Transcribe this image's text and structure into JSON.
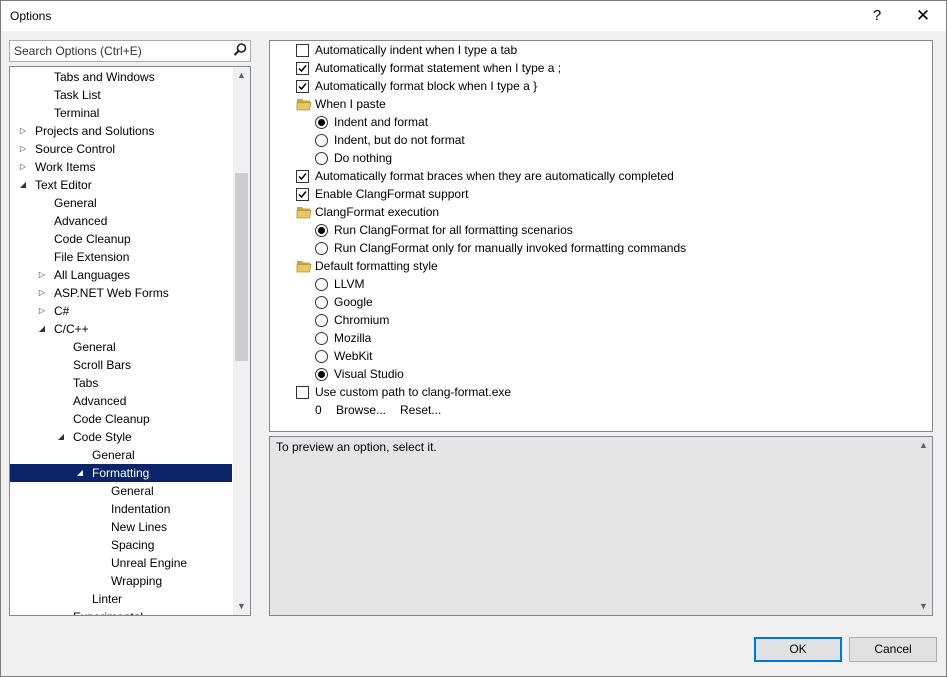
{
  "window": {
    "title": "Options",
    "help_label": "?",
    "close_label": "✕"
  },
  "search": {
    "placeholder": "Search Options (Ctrl+E)"
  },
  "tree": {
    "items": [
      {
        "label": "Tabs and Windows",
        "level": 2,
        "expander": ""
      },
      {
        "label": "Task List",
        "level": 2,
        "expander": ""
      },
      {
        "label": "Terminal",
        "level": 2,
        "expander": ""
      },
      {
        "label": "Projects and Solutions",
        "level": 1,
        "expander": "collapsed"
      },
      {
        "label": "Source Control",
        "level": 1,
        "expander": "collapsed"
      },
      {
        "label": "Work Items",
        "level": 1,
        "expander": "collapsed"
      },
      {
        "label": "Text Editor",
        "level": 1,
        "expander": "expanded"
      },
      {
        "label": "General",
        "level": 2,
        "expander": ""
      },
      {
        "label": "Advanced",
        "level": 2,
        "expander": ""
      },
      {
        "label": "Code Cleanup",
        "level": 2,
        "expander": ""
      },
      {
        "label": "File Extension",
        "level": 2,
        "expander": ""
      },
      {
        "label": "All Languages",
        "level": 2,
        "expander": "collapsed"
      },
      {
        "label": "ASP.NET Web Forms",
        "level": 2,
        "expander": "collapsed"
      },
      {
        "label": "C#",
        "level": 2,
        "expander": "collapsed"
      },
      {
        "label": "C/C++",
        "level": 2,
        "expander": "expanded"
      },
      {
        "label": "General",
        "level": 3,
        "expander": ""
      },
      {
        "label": "Scroll Bars",
        "level": 3,
        "expander": ""
      },
      {
        "label": "Tabs",
        "level": 3,
        "expander": ""
      },
      {
        "label": "Advanced",
        "level": 3,
        "expander": ""
      },
      {
        "label": "Code Cleanup",
        "level": 3,
        "expander": ""
      },
      {
        "label": "Code Style",
        "level": 3,
        "expander": "expanded"
      },
      {
        "label": "General",
        "level": 4,
        "expander": ""
      },
      {
        "label": "Formatting",
        "level": 4,
        "expander": "expanded",
        "selected": true
      },
      {
        "label": "General",
        "level": 5,
        "expander": ""
      },
      {
        "label": "Indentation",
        "level": 5,
        "expander": ""
      },
      {
        "label": "New Lines",
        "level": 5,
        "expander": ""
      },
      {
        "label": "Spacing",
        "level": 5,
        "expander": ""
      },
      {
        "label": "Unreal Engine",
        "level": 5,
        "expander": ""
      },
      {
        "label": "Wrapping",
        "level": 5,
        "expander": ""
      },
      {
        "label": "Linter",
        "level": 4,
        "expander": ""
      },
      {
        "label": "Experimental",
        "level": 3,
        "expander": ""
      }
    ]
  },
  "options": [
    {
      "type": "checkbox",
      "checked": false,
      "indent": 0,
      "label": "Automatically indent when I type a tab"
    },
    {
      "type": "checkbox",
      "checked": true,
      "indent": 0,
      "label": "Automatically format statement when I type a ;"
    },
    {
      "type": "checkbox",
      "checked": true,
      "indent": 0,
      "label": "Automatically format block when I type a }"
    },
    {
      "type": "folder",
      "indent": 0,
      "label": "When I paste"
    },
    {
      "type": "radio",
      "checked": true,
      "indent": 1,
      "label": "Indent and format"
    },
    {
      "type": "radio",
      "checked": false,
      "indent": 1,
      "label": "Indent, but do not format"
    },
    {
      "type": "radio",
      "checked": false,
      "indent": 1,
      "label": "Do nothing"
    },
    {
      "type": "checkbox",
      "checked": true,
      "indent": 0,
      "label": "Automatically format braces when they are automatically completed"
    },
    {
      "type": "checkbox",
      "checked": true,
      "indent": 0,
      "label": "Enable ClangFormat support"
    },
    {
      "type": "folder",
      "indent": 0,
      "label": "ClangFormat execution"
    },
    {
      "type": "radio",
      "checked": true,
      "indent": 1,
      "label": "Run ClangFormat for all formatting scenarios"
    },
    {
      "type": "radio",
      "checked": false,
      "indent": 1,
      "label": "Run ClangFormat only for manually invoked formatting commands"
    },
    {
      "type": "folder",
      "indent": 0,
      "label": "Default formatting style"
    },
    {
      "type": "radio",
      "checked": false,
      "indent": 1,
      "label": "LLVM"
    },
    {
      "type": "radio",
      "checked": false,
      "indent": 1,
      "label": "Google"
    },
    {
      "type": "radio",
      "checked": false,
      "indent": 1,
      "label": "Chromium"
    },
    {
      "type": "radio",
      "checked": false,
      "indent": 1,
      "label": "Mozilla"
    },
    {
      "type": "radio",
      "checked": false,
      "indent": 1,
      "label": "WebKit"
    },
    {
      "type": "radio",
      "checked": true,
      "indent": 1,
      "label": "Visual Studio"
    },
    {
      "type": "checkbox",
      "checked": false,
      "indent": 0,
      "label": "Use custom path to clang-format.exe"
    },
    {
      "type": "links",
      "indent": 1,
      "value": "0",
      "browse": "Browse...",
      "reset": "Reset..."
    }
  ],
  "preview": {
    "message": "To preview an option, select it."
  },
  "buttons": {
    "ok": "OK",
    "cancel": "Cancel"
  },
  "colors": {
    "selection": "#0a246a",
    "ok_border": "#0078d7"
  }
}
